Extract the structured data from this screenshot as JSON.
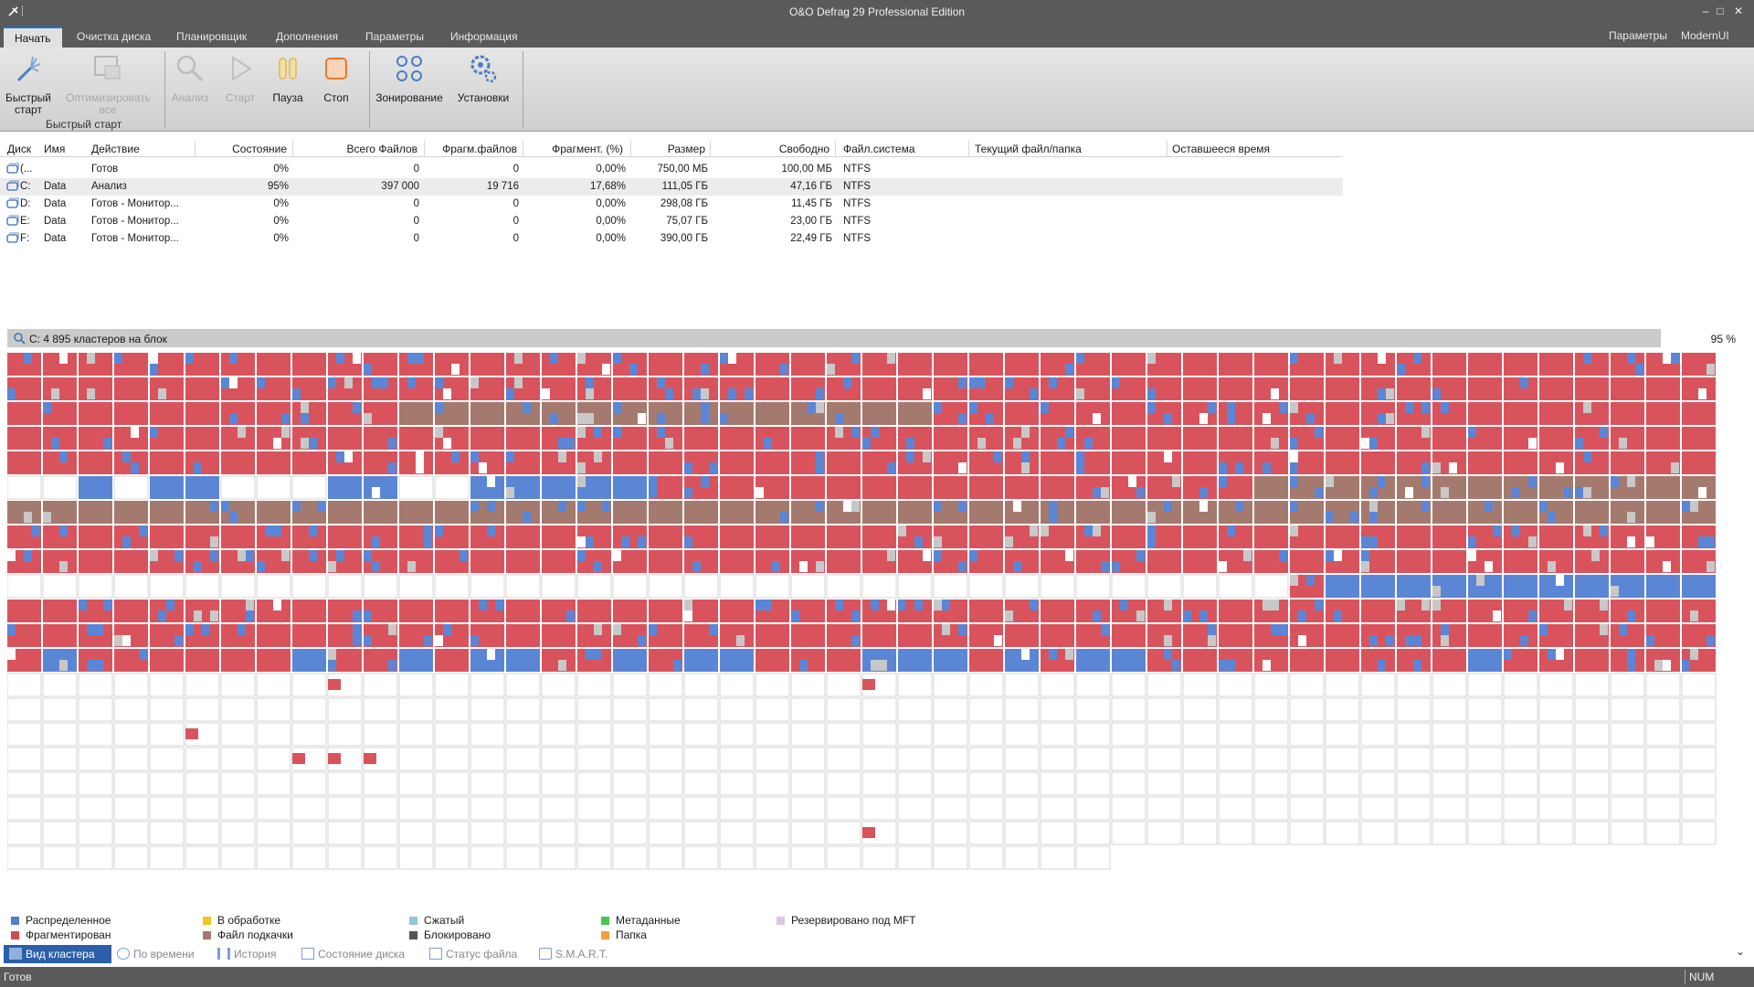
{
  "window": {
    "title": "O&O Defrag 29 Professional Edition",
    "min": "‒",
    "max": "□",
    "close": "✕"
  },
  "tabs": [
    "Начать",
    "Очистка диска",
    "Планировщик",
    "Дополнения",
    "Параметры",
    "Информация"
  ],
  "right_tabs": {
    "params": "Параметры",
    "modernui": "ModernUI"
  },
  "ribbon": {
    "quick_start": "Быстрый старт",
    "optimize_all": "Оптимизировать все",
    "group_label": "Быстрый старт",
    "analyze": "Анализ",
    "start": "Старт",
    "pause": "Пауза",
    "stop": "Стоп",
    "zoning": "Зонирование",
    "settings": "Установки"
  },
  "table": {
    "headers": [
      "Диск",
      "Имя",
      "Действие",
      "Состояние",
      "Всего Файлов",
      "Фрагм.файлов",
      "Фрагмент. (%)",
      "Размер",
      "Свободно",
      "Файл.система",
      "Текущий файл/папка",
      "Оставшееся время"
    ],
    "rows": [
      [
        "(...",
        "",
        "Готов",
        "0%",
        "0",
        "0",
        "0,00%",
        "750,00 МБ",
        "100,00 МБ",
        "NTFS"
      ],
      [
        "C:",
        "Data",
        "Анализ",
        "95%",
        "397 000",
        "19 716",
        "17,68%",
        "111,05 ГБ",
        "47,16 ГБ",
        "NTFS"
      ],
      [
        "D:",
        "Data",
        "Готов - Монитор...",
        "0%",
        "0",
        "0",
        "0,00%",
        "298,08 ГБ",
        "11,45 ГБ",
        "NTFS"
      ],
      [
        "E:",
        "Data",
        "Готов - Монитор...",
        "0%",
        "0",
        "0",
        "0,00%",
        "75,07 ГБ",
        "23,00 ГБ",
        "NTFS"
      ],
      [
        "F:",
        "Data",
        "Готов - Монитор...",
        "0%",
        "0",
        "0",
        "0,00%",
        "390,00 ГБ",
        "22,49 ГБ",
        "NTFS"
      ]
    ]
  },
  "cluster": {
    "header": "C: 4 895 кластеров на блок",
    "percent": "95 %",
    "colors": {
      "allocated": "#5b86d6",
      "fragmented": "#d9535d",
      "paging": "#a57a6e",
      "free": "#ffffff",
      "compressed": "#c8c8c8",
      "locked": "#555555"
    }
  },
  "legend": [
    {
      "label": "Распределенное",
      "color": "#4f7fd4"
    },
    {
      "label": "Фрагментирован",
      "color": "#d24a55"
    },
    {
      "label": "В обработке",
      "color": "#f3c524"
    },
    {
      "label": "Файл подкачки",
      "color": "#a57a6e"
    },
    {
      "label": "Сжатый",
      "color": "#8cc9d6"
    },
    {
      "label": "Блокировано",
      "color": "#555555"
    },
    {
      "label": "Метаданные",
      "color": "#4fc24f"
    },
    {
      "label": "Папка",
      "color": "#f0a040"
    },
    {
      "label": "Резервировано под MFT",
      "color": "#d9c8e6"
    }
  ],
  "bottom_tabs": [
    "Вид кластера",
    "По времени",
    "История",
    "Состояние диска",
    "Статус файла",
    "S.M.A.R.T."
  ],
  "status": {
    "text": "Готов",
    "num": "NUM"
  }
}
